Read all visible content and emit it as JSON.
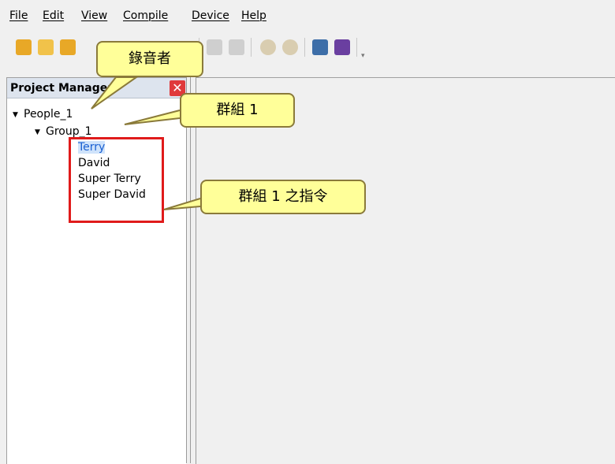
{
  "menu": {
    "file": "File",
    "edit": "Edit",
    "view": "View",
    "compile": "Compile",
    "device": "Device",
    "help": "Help"
  },
  "toolbar": {
    "buttons": [
      "new-project-icon",
      "open-folder-icon",
      "save-icon",
      "undo-icon",
      "redo-icon",
      "zoom-in-icon",
      "zoom-out-icon",
      "waveform-icon",
      "spectrum-icon"
    ]
  },
  "project_manager": {
    "title": "Project Manager",
    "close_label": "✕",
    "tree": {
      "root": "People_1",
      "group": "Group_1",
      "commands": [
        "Terry",
        "David",
        "Super Terry",
        "Super David"
      ]
    }
  },
  "annotations": {
    "recorder": "錄音者",
    "group": "群組 1",
    "group_commands": "群組 1 之指令"
  },
  "colors": {
    "callout_fill": "#ffff99",
    "highlight_box": "#e01b1b",
    "selection": "#cfe3fb"
  }
}
